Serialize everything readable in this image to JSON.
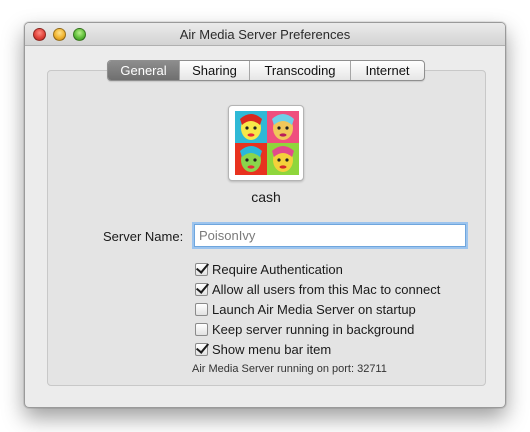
{
  "window": {
    "title": "Air Media Server Preferences"
  },
  "tabs": [
    {
      "label": "General",
      "active": true
    },
    {
      "label": "Sharing",
      "active": false
    },
    {
      "label": "Transcoding",
      "active": false
    },
    {
      "label": "Internet",
      "active": false
    }
  ],
  "user": {
    "name": "cash"
  },
  "server_name": {
    "label": "Server Name:",
    "value": "",
    "placeholder": "PoisonIvy"
  },
  "options": [
    {
      "label": "Require Authentication",
      "checked": true
    },
    {
      "label": "Allow all users from this Mac to connect",
      "checked": true
    },
    {
      "label": "Launch Air Media Server on startup",
      "checked": false
    },
    {
      "label": "Keep server running in background",
      "checked": false
    },
    {
      "label": "Show menu bar item",
      "checked": true
    }
  ],
  "status": {
    "text": "Air Media Server running on port: 32711"
  },
  "colors": {
    "active_tab": "#7a7a7a",
    "focus_ring": "#9cc4ee",
    "close_button": "#e0443c",
    "minimize_button": "#f0b431",
    "zoom_button": "#5fbe3a"
  }
}
